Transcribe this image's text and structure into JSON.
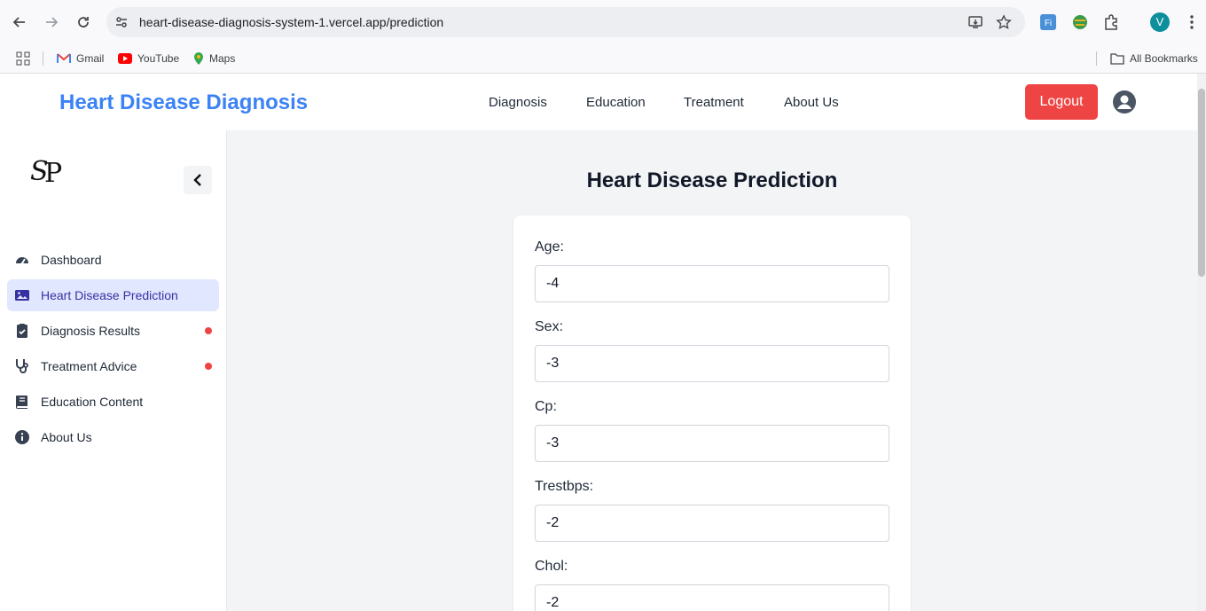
{
  "browser": {
    "url": "heart-disease-diagnosis-system-1.vercel.app/prediction",
    "profile_initial": "V",
    "bookmarks": [
      {
        "label": "Gmail",
        "icon": "gmail-icon"
      },
      {
        "label": "YouTube",
        "icon": "youtube-icon"
      },
      {
        "label": "Maps",
        "icon": "maps-icon"
      }
    ],
    "all_bookmarks": "All Bookmarks"
  },
  "header": {
    "brand": "Heart Disease Diagnosis",
    "nav": [
      "Diagnosis",
      "Education",
      "Treatment",
      "About Us"
    ],
    "logout": "Logout"
  },
  "sidebar": {
    "logo_text": "SP",
    "items": [
      {
        "label": "Dashboard",
        "icon": "dashboard-icon",
        "active": false,
        "dot": false
      },
      {
        "label": "Heart Disease Prediction",
        "icon": "image-icon",
        "active": true,
        "dot": false
      },
      {
        "label": "Diagnosis Results",
        "icon": "clipboard-check-icon",
        "active": false,
        "dot": true
      },
      {
        "label": "Treatment Advice",
        "icon": "stethoscope-icon",
        "active": false,
        "dot": true
      },
      {
        "label": "Education Content",
        "icon": "book-icon",
        "active": false,
        "dot": false
      },
      {
        "label": "About Us",
        "icon": "info-icon",
        "active": false,
        "dot": false
      }
    ]
  },
  "main": {
    "title": "Heart Disease Prediction",
    "fields": [
      {
        "label": "Age:",
        "value": "-4"
      },
      {
        "label": "Sex:",
        "value": "-3"
      },
      {
        "label": "Cp:",
        "value": "-3"
      },
      {
        "label": "Trestbps:",
        "value": "-2"
      },
      {
        "label": "Chol:",
        "value": "-2"
      }
    ]
  },
  "colors": {
    "brand": "#3b82f6",
    "logout": "#ef4444",
    "active_bg": "#e0e7ff",
    "active_text": "#3730a3",
    "dot": "#ef4444"
  }
}
